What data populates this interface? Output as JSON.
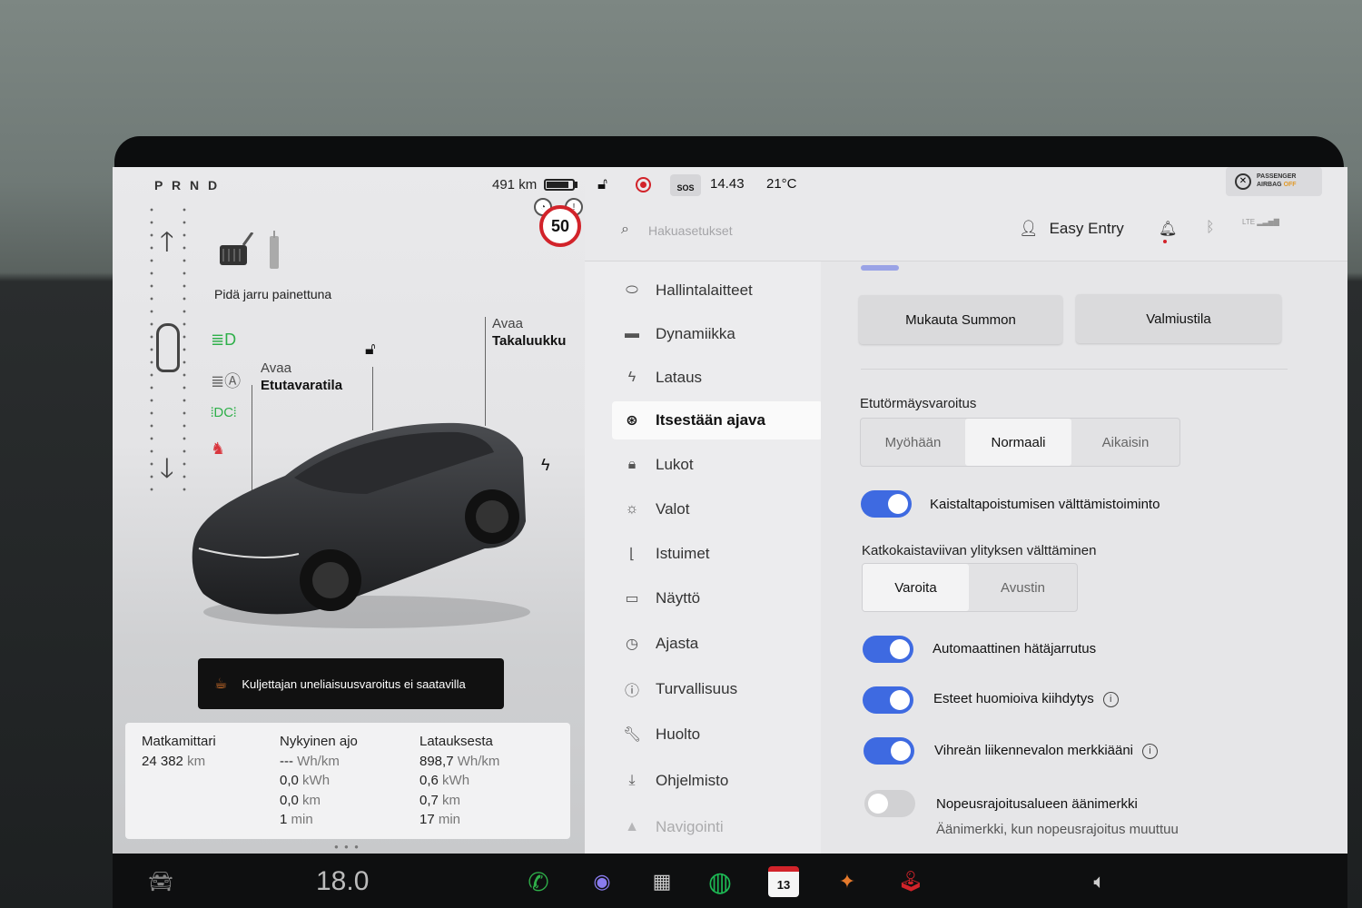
{
  "status_left": {
    "gear": "P R N D",
    "range": "491 km",
    "speed_limit": "50"
  },
  "drive": {
    "brake_prompt": "Pidä jarru painettuna",
    "front_trunk_action": "Avaa",
    "front_trunk_label": "Etutavaratila",
    "rear_trunk_action": "Avaa",
    "rear_trunk_label": "Takaluukku",
    "toast": "Kuljettajan uneliaisuusvaroitus ei saatavilla"
  },
  "trip": {
    "odometer": {
      "title": "Matkamittari",
      "value": "24 382",
      "unit": "km"
    },
    "current": {
      "title": "Nykyinen ajo",
      "rows": [
        {
          "value": "---",
          "unit": "Wh/km"
        },
        {
          "value": "0,0",
          "unit": "kWh"
        },
        {
          "value": "0,0",
          "unit": "km"
        },
        {
          "value": "1",
          "unit": "min"
        }
      ]
    },
    "since_charge": {
      "title": "Latauksesta",
      "rows": [
        {
          "value": "898,7",
          "unit": "Wh/km"
        },
        {
          "value": "0,6",
          "unit": "kWh"
        },
        {
          "value": "0,7",
          "unit": "km"
        },
        {
          "value": "17",
          "unit": "min"
        }
      ]
    }
  },
  "status_right": {
    "sos": "SOS",
    "time": "14.43",
    "outside_temp": "21°C",
    "airbag_line1": "PASSENGER",
    "airbag_line2": "AIRBAG",
    "airbag_state": "OFF"
  },
  "topbar": {
    "search_placeholder": "Hakuasetukset",
    "profile": "Easy Entry",
    "network": "LTE"
  },
  "menu": [
    {
      "label": "Hallintalaitteet",
      "icon": "toggle-icon"
    },
    {
      "label": "Dynamiikka",
      "icon": "car-icon"
    },
    {
      "label": "Lataus",
      "icon": "bolt-icon"
    },
    {
      "label": "Itsestään ajava",
      "icon": "steering-wheel-icon",
      "active": true
    },
    {
      "label": "Lukot",
      "icon": "lock-icon"
    },
    {
      "label": "Valot",
      "icon": "sun-icon"
    },
    {
      "label": "Istuimet",
      "icon": "seat-icon"
    },
    {
      "label": "Näyttö",
      "icon": "display-icon"
    },
    {
      "label": "Ajasta",
      "icon": "clock-icon"
    },
    {
      "label": "Turvallisuus",
      "icon": "alert-icon"
    },
    {
      "label": "Huolto",
      "icon": "wrench-icon"
    },
    {
      "label": "Ohjelmisto",
      "icon": "download-icon"
    },
    {
      "label": "Navigointi",
      "icon": "navigation-icon"
    }
  ],
  "content": {
    "summon_button": "Mukauta Summon",
    "standby_button": "Valmiustila",
    "fcw": {
      "title": "Etutörmäysvaroitus",
      "options": [
        "Myöhään",
        "Normaali",
        "Aikaisin"
      ],
      "selected": "Normaali"
    },
    "lane_departure": {
      "label": "Kaistaltapoistumisen välttämistoiminto",
      "on": true
    },
    "blind_spot": {
      "title": "Katkokaistaviivan ylityksen välttäminen",
      "options": [
        "Varoita",
        "Avustin"
      ],
      "selected": "Varoita"
    },
    "aeb": {
      "label": "Automaattinen hätäjarrutus",
      "on": true
    },
    "obstacle": {
      "label": "Esteet huomioiva kiihdytys",
      "on": true
    },
    "green_light": {
      "label": "Vihreän liikennevalon merkkiääni",
      "on": true
    },
    "speed_zone": {
      "label": "Nopeusrajoitusalueen äänimerkki",
      "sublabel": "Äänimerkki, kun nopeusrajoitus muuttuu",
      "on": false
    }
  },
  "dock": {
    "cabin_temp": "18.0",
    "calendar_day": "13"
  },
  "colors": {
    "accent": "#3e6ae1",
    "alert": "#d2232a",
    "ok": "#2fb04a"
  }
}
